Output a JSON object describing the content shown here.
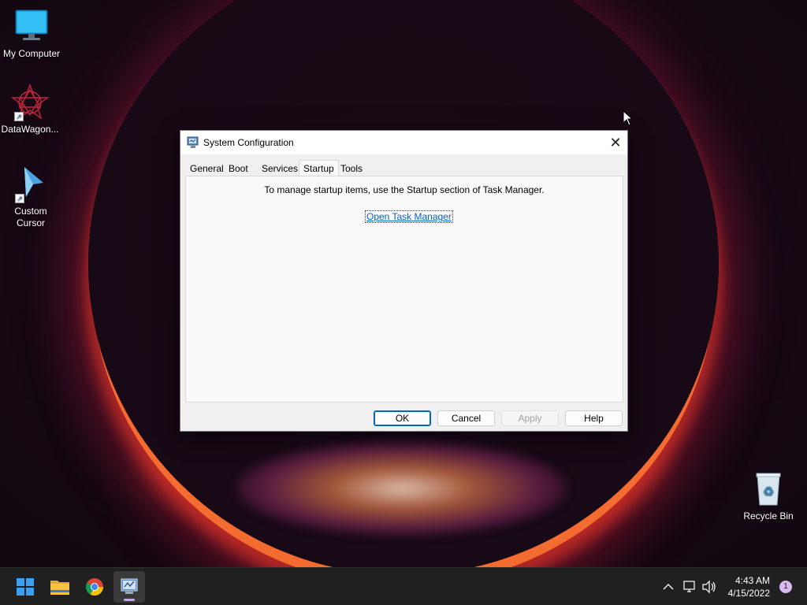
{
  "desktop": {
    "icons": [
      {
        "label": "My Computer",
        "icon": "monitor-icon"
      },
      {
        "label": "DataWagon...",
        "icon": "datawagon-icon"
      },
      {
        "label": "Custom Cursor",
        "icon": "custom-cursor-icon"
      },
      {
        "label": "Recycle Bin",
        "icon": "recycle-bin-icon"
      }
    ]
  },
  "dialog": {
    "title": "System Configuration",
    "close_label": "✕",
    "tabs": [
      "General",
      "Boot",
      "Services",
      "Startup",
      "Tools"
    ],
    "active_tab": "Startup",
    "message": "To manage startup items, use the Startup section of Task Manager.",
    "link": "Open Task Manager",
    "buttons": {
      "ok": "OK",
      "cancel": "Cancel",
      "apply": "Apply",
      "help": "Help"
    }
  },
  "taskbar": {
    "apps": [
      "start-icon",
      "file-explorer-icon",
      "chrome-icon",
      "system-configuration-icon"
    ],
    "time": "4:43 AM",
    "date": "4/15/2022",
    "notification_count": "1"
  },
  "colors": {
    "accent": "#0067c0",
    "link": "#0066cc"
  }
}
